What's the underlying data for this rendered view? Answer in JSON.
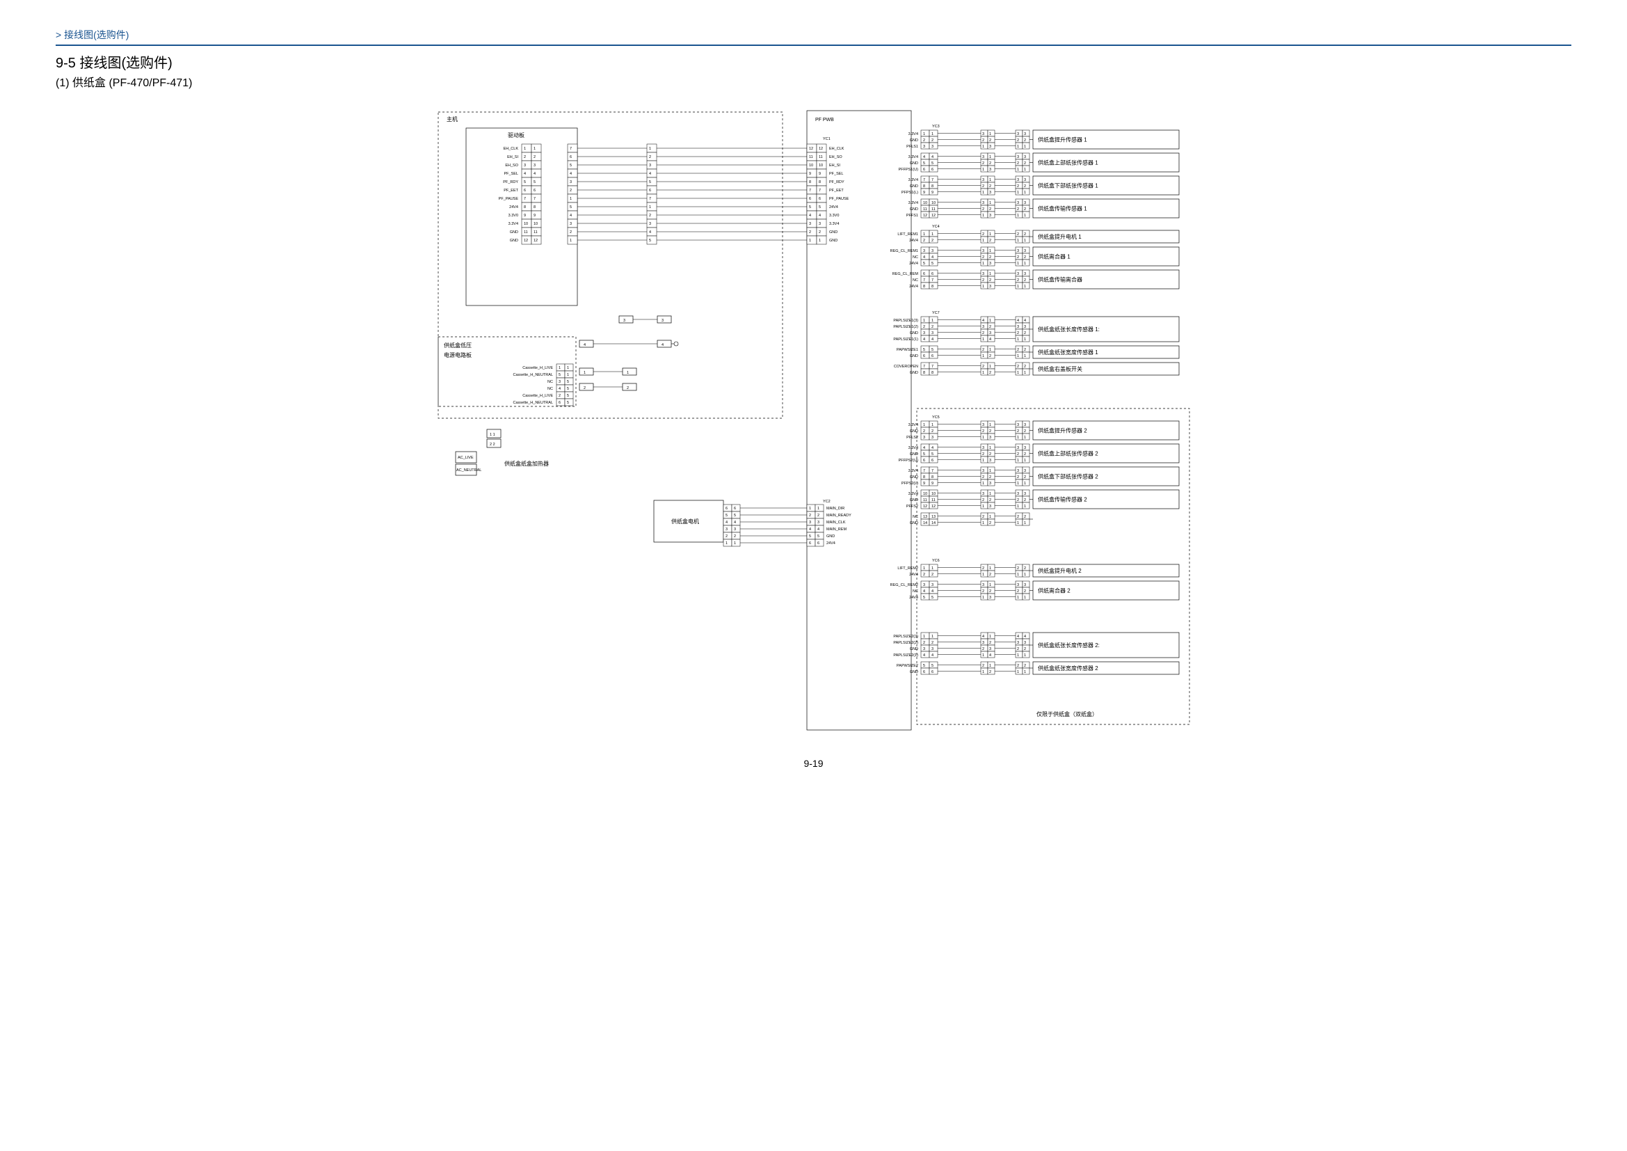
{
  "breadcrumb": "> 接线图(选购件)",
  "section_heading": "9-5  接线图(选购件)",
  "sub_heading": "(1)  供纸盒  (PF-470/PF-471)",
  "page_number": "9-19",
  "blocks": {
    "main_unit": "主机",
    "drive_pwb": "驱动板",
    "pf_pwb": "PF PWB",
    "cassette_low_psu": "供纸盒低压",
    "psu_pwb": "电源电路板",
    "cassette_heater": "供纸盒纸盒加热器",
    "pf_motor": "供纸盒电机",
    "double_cassette_note": "仅限于供纸盒（双纸盒）"
  },
  "drive_signals": [
    "EH_CLK",
    "EH_SI",
    "EH_SO",
    "PF_SEL",
    "PF_RDY",
    "PF_EET",
    "PF_PAUSE",
    "24V4",
    "3.3V0",
    "3.3V4",
    "GND",
    "GND"
  ],
  "drive_pins_left": [
    "1",
    "2",
    "3",
    "4",
    "5",
    "6",
    "7",
    "8",
    "9",
    "10",
    "11",
    "12"
  ],
  "drive_pins_right": [
    "7",
    "6",
    "5",
    "4",
    "3",
    "2",
    "1",
    "5",
    "4",
    "3",
    "2",
    "1"
  ],
  "yc1_signals": [
    "EH_CLK",
    "EH_SO",
    "EH_SI",
    "PF_SEL",
    "PF_RDY",
    "PF_EET",
    "PF_PAUSE",
    "24V4",
    "3.3V0",
    "3.3V4",
    "GND",
    "GND"
  ],
  "yc1_pins_left": [
    "1",
    "2",
    "3",
    "4",
    "5",
    "6",
    "7",
    "1",
    "2",
    "3",
    "4",
    "5"
  ],
  "yc1_pins_right": [
    "12",
    "11",
    "10",
    "9",
    "8",
    "7",
    "6",
    "5",
    "4",
    "3",
    "2",
    "1"
  ],
  "psu_signals": [
    "Cassette_H_LIVE",
    "Cassette_H_NEUTRAL",
    "NC",
    "NC",
    "Cassette_H_LIVE",
    "Cassette_H_NEUTRAL"
  ],
  "psu_pins": [
    "1",
    "5",
    "3",
    "4",
    "2",
    "6"
  ],
  "ac_labels": [
    "AC_LIVE",
    "AC_NEUTRAL"
  ],
  "yc2_label": "YC2",
  "yc2_signals": [
    "MAIN_DIR",
    "MAIN_READY",
    "MAIN_CLK",
    "MAIN_REM",
    "GND",
    "24V4"
  ],
  "yc2_pins_left": [
    "6",
    "5",
    "4",
    "3",
    "2",
    "1"
  ],
  "yc2_pins_right": [
    "1",
    "2",
    "3",
    "4",
    "5",
    "6"
  ],
  "yc3_label": "YC3",
  "yc4_label": "YC4",
  "yc5_label": "YC5",
  "yc6_label": "YC6",
  "yc7_label": "YC7",
  "sensors": {
    "yc3": [
      {
        "signals": [
          "3.3V4",
          "GND",
          "PFLS1"
        ],
        "pins": [
          "1",
          "2",
          "3"
        ],
        "name": "供纸盒提升传感器 1"
      },
      {
        "signals": [
          "3.3V4",
          "GND",
          "PFFPS1(U)"
        ],
        "pins": [
          "4",
          "5",
          "6"
        ],
        "name": "供纸盒上部纸张传感器 1"
      },
      {
        "signals": [
          "3.3V4",
          "GND",
          "PFPS1(L)"
        ],
        "pins": [
          "7",
          "8",
          "9"
        ],
        "name": "供纸盒下部纸张传感器 1"
      },
      {
        "signals": [
          "3.3V4",
          "GND",
          "PFFS1"
        ],
        "pins": [
          "10",
          "11",
          "12"
        ],
        "name": "供纸盒传输传感器 1"
      }
    ],
    "yc4": [
      {
        "signals": [
          "LIFT_REM1",
          "24V4"
        ],
        "pins": [
          "1",
          "2"
        ],
        "name": "供纸盒提升电机 1"
      },
      {
        "signals": [
          "REG_CL_REM1",
          "NC",
          "24V4"
        ],
        "pins": [
          "3",
          "4",
          "5"
        ],
        "name": "供纸离合器 1"
      },
      {
        "signals": [
          "REG_CL_REM",
          "NC",
          "24V4"
        ],
        "pins": [
          "6",
          "7",
          "8"
        ],
        "name": "供纸盒传输离合器"
      }
    ],
    "yc7": [
      {
        "signals": [
          "PAPLSIZE1(3)",
          "PAPLSIZE1(2)",
          "GND",
          "PAPLSIZE1(1)"
        ],
        "pins": [
          "1",
          "2",
          "3",
          "4"
        ],
        "name": "供纸盒纸张长度传感器 1:"
      },
      {
        "signals": [
          "PAPWSIZE1",
          "GND"
        ],
        "pins": [
          "5",
          "6"
        ],
        "name": "供纸盒纸张宽度传感器 1"
      },
      {
        "signals": [
          "COVEROPEN",
          "GND"
        ],
        "pins": [
          "7",
          "8"
        ],
        "name": "供纸盒右盖板开关"
      }
    ],
    "yc5": [
      {
        "signals": [
          "3.3V4",
          "GND",
          "PFLS2"
        ],
        "pins": [
          "1",
          "2",
          "3"
        ],
        "name": "供纸盒提升传感器 2"
      },
      {
        "signals": [
          "3.3V4",
          "GND",
          "PFFPS2(U)"
        ],
        "pins": [
          "4",
          "5",
          "6"
        ],
        "name": "供纸盒上部纸张传感器 2"
      },
      {
        "signals": [
          "3.3V4",
          "GND",
          "PFPS2(L)"
        ],
        "pins": [
          "7",
          "8",
          "9"
        ],
        "name": "供纸盒下部纸张传感器 2"
      },
      {
        "signals": [
          "3.3V4",
          "GND",
          "PFFS2"
        ],
        "pins": [
          "10",
          "11",
          "12"
        ],
        "name": "供纸盒传输传感器 2"
      },
      {
        "signals": [
          "NC",
          "GND"
        ],
        "pins": [
          "13",
          "14"
        ],
        "name": ""
      }
    ],
    "yc6": [
      {
        "signals": [
          "LIFT_REM2",
          "24V4"
        ],
        "pins": [
          "1",
          "2"
        ],
        "name": "供纸盒提升电机 2"
      },
      {
        "signals": [
          "REG_CL_REM2",
          "NC",
          "24V4"
        ],
        "pins": [
          "3",
          "4",
          "5"
        ],
        "name": "供纸离合器 2"
      }
    ],
    "yc7b": [
      {
        "signals": [
          "PAPLSIZE2(3)",
          "PAPLSIZE2(2)",
          "GND",
          "PAPLSIZE2(1)"
        ],
        "pins": [
          "1",
          "2",
          "3",
          "4"
        ],
        "name": "供纸盒纸张长度传感器 2:"
      },
      {
        "signals": [
          "PAPWSIZE2",
          "GND"
        ],
        "pins": [
          "5",
          "6"
        ],
        "name": "供纸盒纸张宽度传感器 2"
      }
    ]
  }
}
